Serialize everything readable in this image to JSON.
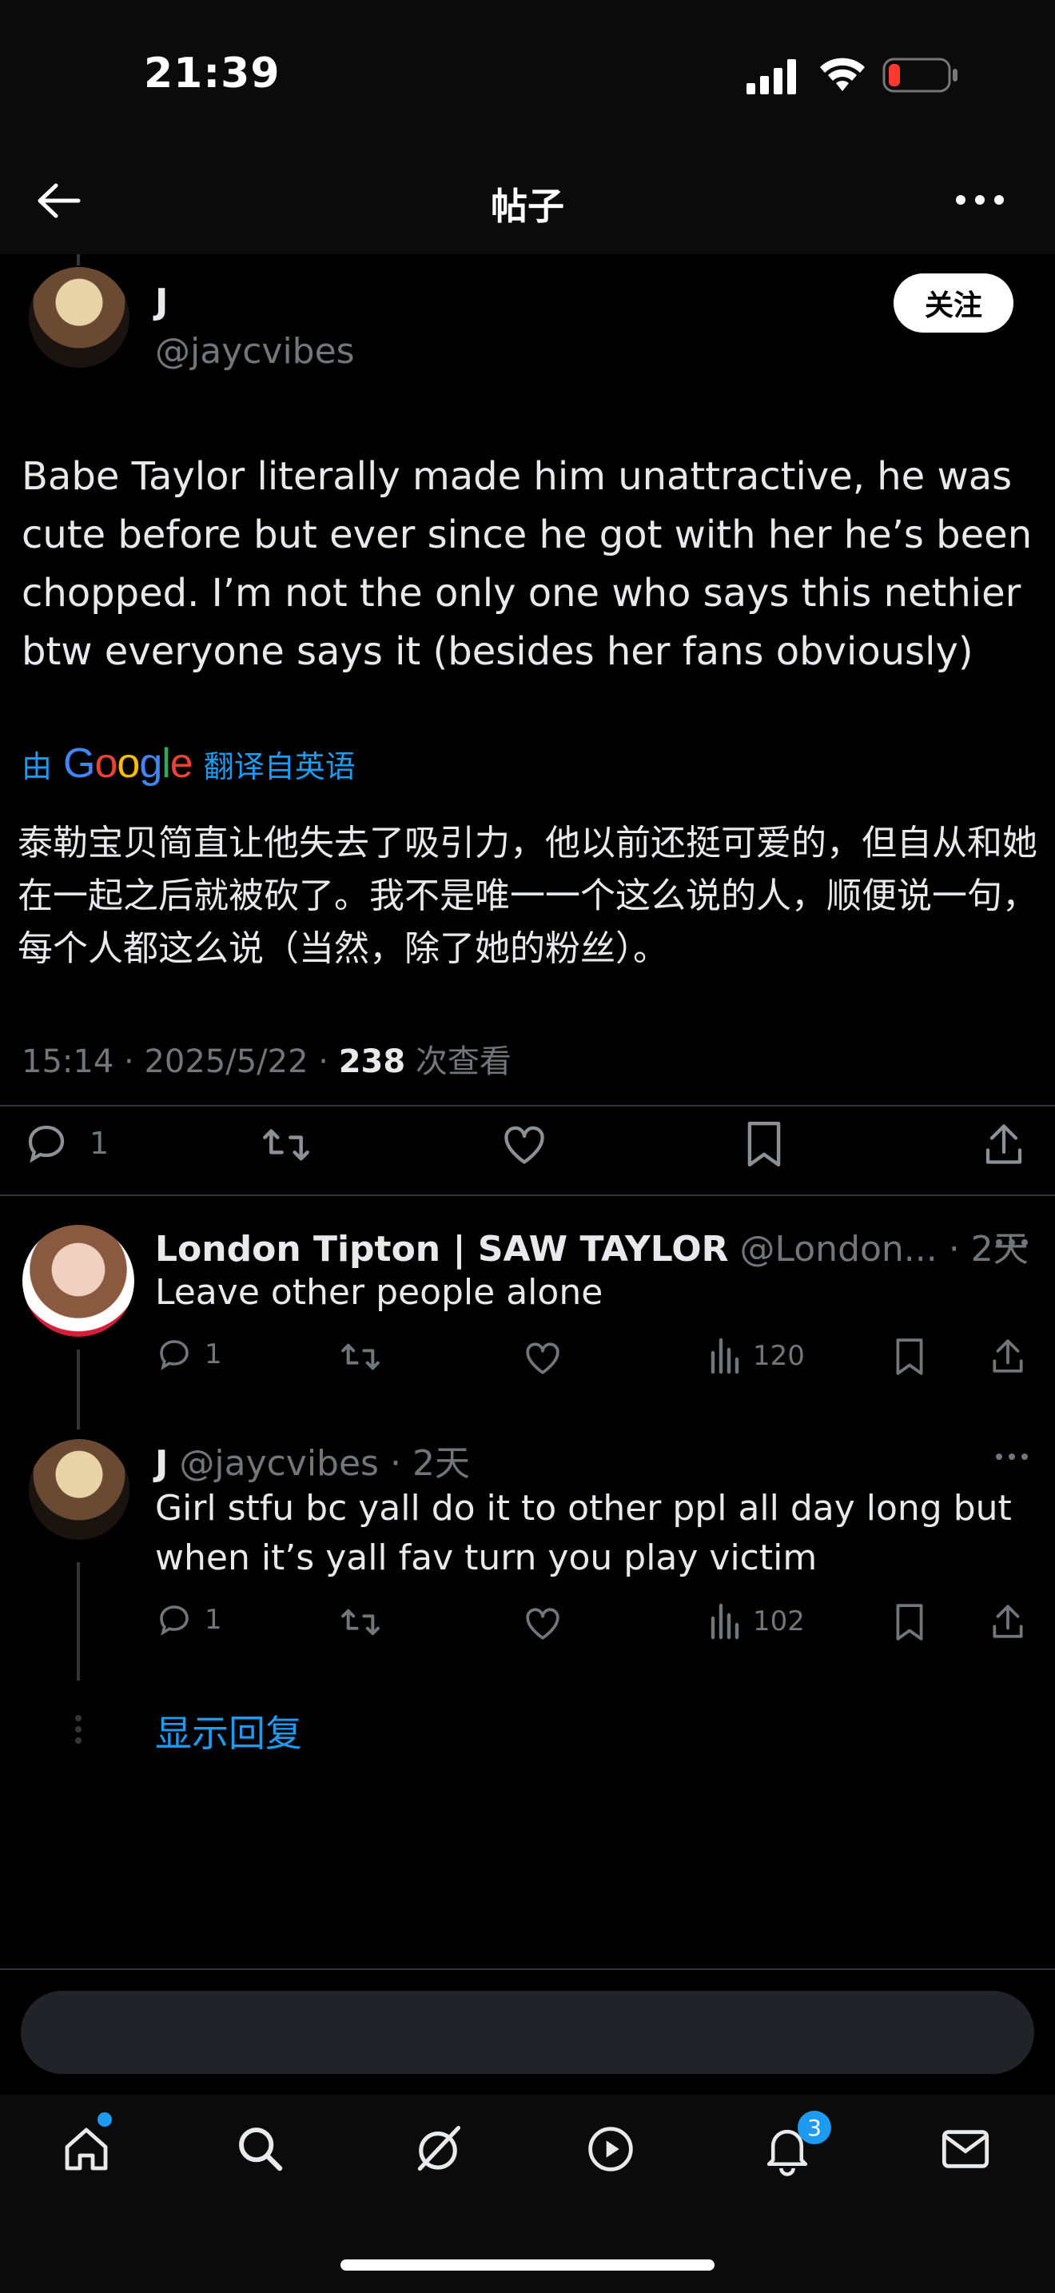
{
  "status_bar": {
    "time": "21:39",
    "battery_color": "#ff3b30"
  },
  "nav": {
    "title": "帖子"
  },
  "post": {
    "author_name": "J",
    "handle": "@jaycvibes",
    "follow_label": "关注",
    "text": "Babe Taylor literally made him unattractive, he was cute before but ever since he got with her he’s been chopped. I’m not the only one who says this nethier btw everyone says it (besides her fans obviously)",
    "translate_prefix": "由",
    "translate_brand": "Google",
    "translate_suffix": "翻译自英语",
    "translated_text": "泰勒宝贝简直让他失去了吸引力，他以前还挺可爱的，但自从和她在一起之后就被砍了。我不是唯一一个这么说的人，顺便说一句，每个人都这么说（当然，除了她的粉丝）。",
    "time": "15:14",
    "date": "2025/5/22",
    "views_count": "238",
    "views_label": "次查看",
    "reply_count": "1"
  },
  "replies": [
    {
      "name": "London Tipton | SAW TAYLOR",
      "handle": "@London...",
      "time": "2天",
      "text": "Leave other people alone",
      "reply_count": "1",
      "views": "120"
    },
    {
      "name": "J",
      "handle": "@jaycvibes",
      "time": "2天",
      "text": "Girl stfu bc yall do it to other ppl all day long but when it’s yall fav turn you play victim",
      "reply_count": "1",
      "views": "102"
    }
  ],
  "show_replies_label": "显示回复",
  "bottom_nav": {
    "notifications_badge": "3"
  },
  "colors": {
    "accent": "#1d9bf0",
    "background": "#000000",
    "secondary_text": "#71767b"
  },
  "icons": [
    "back-arrow-icon",
    "more-icon",
    "reply-icon",
    "retweet-icon",
    "like-icon",
    "bookmark-icon",
    "share-icon",
    "views-icon",
    "home-icon",
    "search-icon",
    "grok-icon",
    "video-icon",
    "bell-icon",
    "mail-icon"
  ]
}
